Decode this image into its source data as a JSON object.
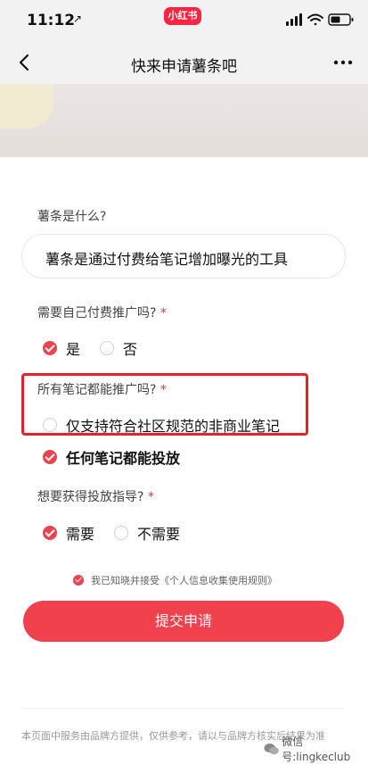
{
  "status_bar": {
    "time": "11:12",
    "location_arrow": "location-arrow-icon",
    "app_badge": "小红书"
  },
  "nav": {
    "title": "快来申请薯条吧"
  },
  "form": {
    "q1": {
      "label": "薯条是什么?",
      "answer": "薯条是通过付费给笔记增加曝光的工具"
    },
    "q2": {
      "label": "需要自己付费推广吗?",
      "required": "*",
      "options": [
        {
          "label": "是",
          "selected": true
        },
        {
          "label": "否",
          "selected": false
        }
      ]
    },
    "q3": {
      "label": "所有笔记都能推广吗?",
      "required": "*",
      "options": [
        {
          "label": "仅支持符合社区规范的非商业笔记",
          "selected": false
        },
        {
          "label": "任何笔记都能投放",
          "selected": true
        }
      ]
    },
    "q4": {
      "label": "想要获得投放指导?",
      "required": "*",
      "options": [
        {
          "label": "需要",
          "selected": true
        },
        {
          "label": "不需要",
          "selected": false
        }
      ]
    },
    "consent": {
      "text": "我已知晓并接受《个人信息收集使用规则》",
      "checked": true
    },
    "submit_label": "提交申请"
  },
  "footer": {
    "disclaimer": "本页面中服务由品牌方提供，仅供参考，请以与品牌方核实后结果为准"
  },
  "watermark": {
    "text": "微信号:lingkeclub"
  },
  "colors": {
    "accent": "#f0414c",
    "highlight_border": "#e5232e",
    "check": "#e94450"
  }
}
